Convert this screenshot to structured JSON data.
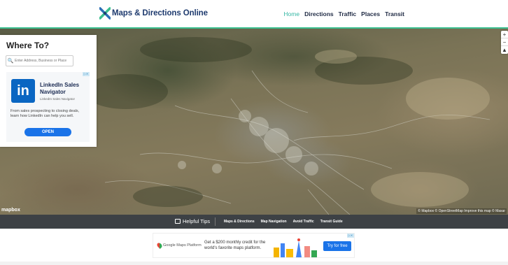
{
  "header": {
    "logo_text": "Maps & Directions Online",
    "nav": [
      {
        "label": "Home",
        "active": true
      },
      {
        "label": "Directions",
        "active": false
      },
      {
        "label": "Traffic",
        "active": false
      },
      {
        "label": "Places",
        "active": false
      },
      {
        "label": "Transit",
        "active": false
      }
    ]
  },
  "where_panel": {
    "title": "Where To?",
    "search_placeholder": "Enter Address, Business or Place",
    "ad": {
      "logo_text": "in",
      "title": "LinkedIn Sales Navigator",
      "subtitle": "LinkedIn Sales Navigator",
      "description": "From sales prospecting to closing deals, learn how LinkedIn can help you sell.",
      "button": "OPEN"
    }
  },
  "map": {
    "zoom_in": "+",
    "zoom_out": "−",
    "compass": "▲",
    "attribution": "© Mapbox © OpenStreetMap Improve this map © Maxar",
    "mapbox_logo": "mapbox"
  },
  "tips_bar": {
    "label": "Helpful Tips",
    "links": [
      "Maps & Directions",
      "Map Navigation",
      "Avoid Traffic",
      "Transit Guide"
    ]
  },
  "bottom_ad": {
    "brand": "Google Maps Platform",
    "text": "Get a $200 monthly credit for the world's favorite maps platform.",
    "button": "Try for free"
  },
  "colors": {
    "accent": "#35b7a4",
    "brand": "#1e3a6e",
    "ad_button": "#1a73e8",
    "linkedin": "#0a66c2",
    "tips_bar": "#3d4145"
  }
}
